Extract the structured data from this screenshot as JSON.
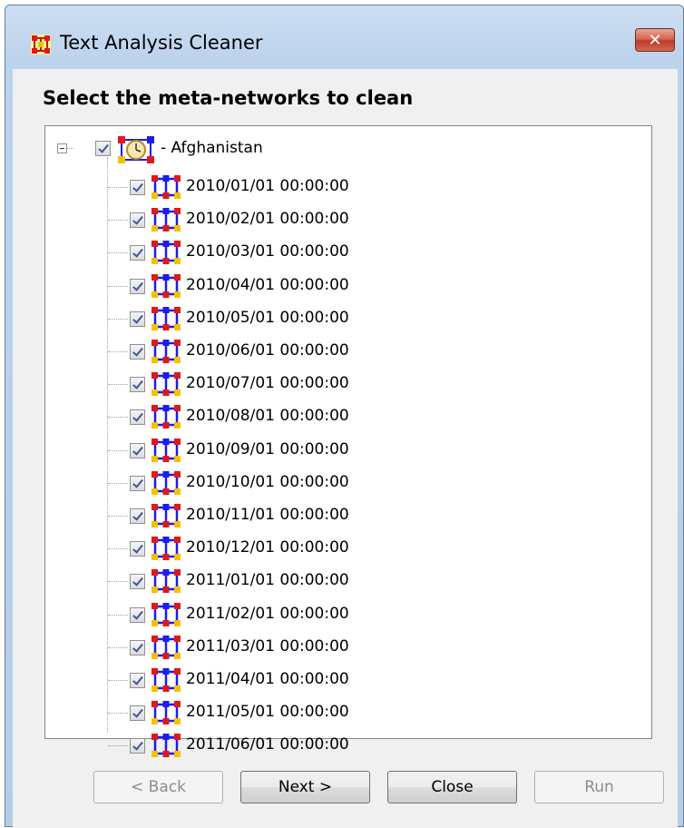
{
  "window": {
    "title": "Text Analysis Cleaner",
    "close_label": "✕"
  },
  "heading": "Select the meta-networks to clean",
  "tree": {
    "root": {
      "label": "- Afghanistan",
      "checked": true,
      "expanded": true
    },
    "children": [
      {
        "label": "2010/01/01 00:00:00",
        "checked": true
      },
      {
        "label": "2010/02/01 00:00:00",
        "checked": true
      },
      {
        "label": "2010/03/01 00:00:00",
        "checked": true
      },
      {
        "label": "2010/04/01 00:00:00",
        "checked": true
      },
      {
        "label": "2010/05/01 00:00:00",
        "checked": true
      },
      {
        "label": "2010/06/01 00:00:00",
        "checked": true
      },
      {
        "label": "2010/07/01 00:00:00",
        "checked": true
      },
      {
        "label": "2010/08/01 00:00:00",
        "checked": true
      },
      {
        "label": "2010/09/01 00:00:00",
        "checked": true
      },
      {
        "label": "2010/10/01 00:00:00",
        "checked": true
      },
      {
        "label": "2010/11/01 00:00:00",
        "checked": true
      },
      {
        "label": "2010/12/01 00:00:00",
        "checked": true
      },
      {
        "label": "2011/01/01 00:00:00",
        "checked": true
      },
      {
        "label": "2011/02/01 00:00:00",
        "checked": true
      },
      {
        "label": "2011/03/01 00:00:00",
        "checked": true
      },
      {
        "label": "2011/04/01 00:00:00",
        "checked": true
      },
      {
        "label": "2011/05/01 00:00:00",
        "checked": true
      },
      {
        "label": "2011/06/01 00:00:00",
        "checked": true
      }
    ]
  },
  "buttons": {
    "back": {
      "label": "< Back",
      "enabled": false
    },
    "next": {
      "label": "Next >",
      "enabled": true
    },
    "close": {
      "label": "Close",
      "enabled": true
    },
    "run": {
      "label": "Run",
      "enabled": false
    }
  },
  "colors": {
    "accent_blue": "#1c1cf0",
    "node_red": "#e01818",
    "node_yellow": "#f2c200",
    "title_bg": "#c4d8ee"
  }
}
